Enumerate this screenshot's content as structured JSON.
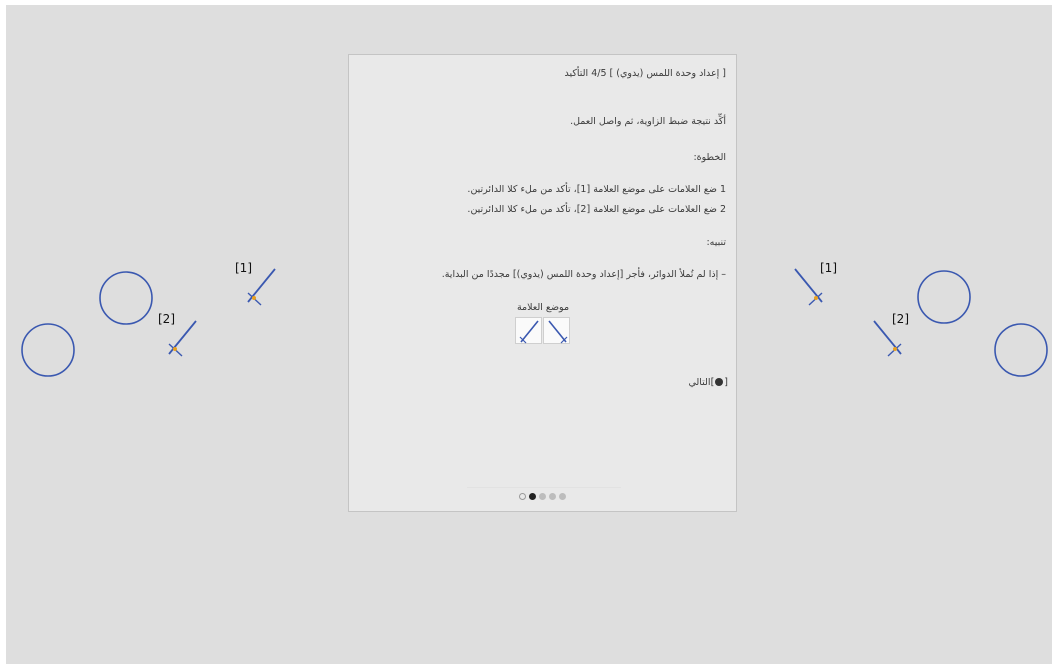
{
  "panel": {
    "title": "[ إعداد وحدة اللمس (يدوي) ]  4/5 التأكيد",
    "instruction": "أكِّد نتيجة ضبط الزاوية، ثم واصل العمل.",
    "step_heading": "الخطوة:",
    "step1": "1 ضع العلامات على موضع العلامة [1]، تأكد من ملء كلا الدائرتين.",
    "step2": "2 ضع العلامات على موضع العلامة [2]، تأكد من ملء كلا الدائرتين.",
    "note_heading": "تنبيه:",
    "warning": "– إذا لم تُملأ الدوائر، فأجر [إعداد وحدة اللمس (يدوي)] مجددًا من البداية.",
    "marker_position_label": "موضع العلامة",
    "next_label": "التالي",
    "next_bracket_open": "[",
    "next_bracket_close": "]",
    "next_icon": "enter-button-icon",
    "pager": {
      "total": 5,
      "current": 2
    }
  },
  "markers": {
    "left_1": "[1]",
    "left_2": "[2]",
    "right_1": "[1]",
    "right_2": "[2]"
  },
  "colors": {
    "screen_background": "#dedede",
    "panel_background": "#e9e9e9",
    "circle_stroke": "#3a58b0",
    "marker_line": "#3a58b0",
    "marker_center": "#e8a020"
  }
}
